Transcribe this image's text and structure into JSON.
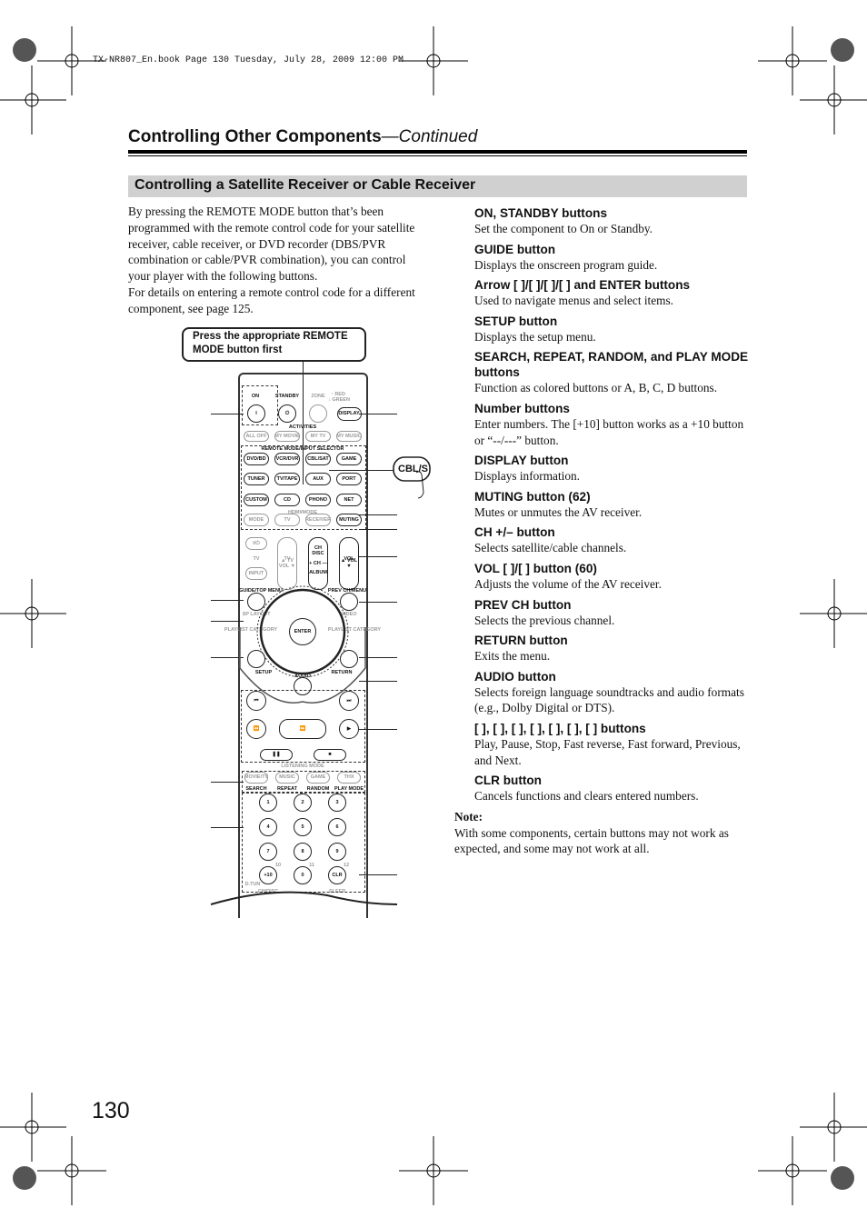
{
  "book_line": "TX-NR807_En.book  Page 130  Tuesday, July 28, 2009  12:00 PM",
  "header": {
    "title": "Controlling Other Components",
    "continued": "—Continued"
  },
  "section_title": "Controlling a Satellite Receiver or Cable Receiver",
  "intro": [
    "By pressing the REMOTE MODE button that’s been programmed with the remote control code for your satellite receiver, cable receiver, or DVD recorder (DBS/PVR combination or cable/PVR combination), you can control your player with the following buttons.",
    "For details on entering a remote control code for a different component, see page 125."
  ],
  "callout": "Press the appropriate REMOTE MODE button first",
  "cbl_callout": "CBL/S",
  "remote": {
    "labels": [
      "ON",
      "STANDBY",
      "ZONE",
      "↑ RED",
      "↓ GREEN",
      "ACTIVITIES",
      "REMOTE MODE/INPUT SELECTOR",
      "HDMI/MODE",
      "TV",
      "TV",
      "VOL",
      "CH",
      "DISC",
      "ALBUM",
      "GUIDE/TOP MENU",
      "PREV CH/MENU",
      "SP LAYOUT",
      "VIDEO",
      "PLAYLIST CATEGORY",
      "PLAYLIST CATEGORY",
      "SETUP",
      "RETURN",
      "AUDIO",
      "LISTENING MODE",
      "SEARCH",
      "REPEAT",
      "RANDOM",
      "PLAY MODE",
      "10",
      "11",
      "12",
      "D.TUN",
      "CH/DISC",
      "SLEEP"
    ],
    "buttons": [
      "I",
      "⏻",
      "",
      "DISPLAY",
      "ALL OFF",
      "MY MOVIE",
      "MY TV",
      "MY MUSIC",
      "DVD/BD",
      "VCR/DVR",
      "CBL/SAT",
      "GAME",
      "TUNER",
      "TV/TAPE",
      "AUX",
      "PORT",
      "CUSTOM",
      "CD",
      "PHONO",
      "NET",
      "MODE",
      "TV",
      "RECEIVER",
      "MUTING",
      "I/⏻",
      "INPUT",
      "▲ TV VOL ▼",
      "+ CH —",
      "▲ VOL ▼",
      "",
      "",
      "ENTER",
      "",
      "",
      "",
      "⏮",
      "⏭",
      "⏪",
      "▶",
      "⏩",
      "❚❚",
      "■",
      "MOVIE/TV",
      "MUSIC",
      "GAME",
      "THX",
      "1",
      "2",
      "3",
      "4",
      "5",
      "6",
      "7",
      "8",
      "9",
      "+10",
      "0",
      "CLR"
    ]
  },
  "items": [
    {
      "title": "ON, STANDBY buttons",
      "desc": "Set the component to On or Standby."
    },
    {
      "title": "GUIDE button",
      "desc": "Displays the onscreen program guide."
    },
    {
      "title": "Arrow [   ]/[   ]/[   ]/[   ] and ENTER buttons",
      "desc": "Used to navigate menus and select items."
    },
    {
      "title": "SETUP button",
      "desc": "Displays the setup menu."
    },
    {
      "title": "SEARCH, REPEAT, RANDOM, and PLAY MODE buttons",
      "desc": "Function as colored buttons or A, B, C, D buttons."
    },
    {
      "title": "Number buttons",
      "desc": "Enter numbers. The [+10] button works as a +10 button or “--/---” button."
    },
    {
      "title": "DISPLAY button",
      "desc": "Displays information."
    },
    {
      "title": "MUTING button (62)",
      "desc": "Mutes or unmutes the AV receiver."
    },
    {
      "title": "CH +/– button",
      "desc": "Selects satellite/cable channels."
    },
    {
      "title": "VOL [   ]/[   ] button (60)",
      "desc": "Adjusts the volume of the AV receiver."
    },
    {
      "title": "PREV CH button",
      "desc": "Selects the previous channel."
    },
    {
      "title": "RETURN button",
      "desc": "Exits the menu."
    },
    {
      "title": "AUDIO button",
      "desc": "Selects foreign language soundtracks and audio formats (e.g., Dolby Digital or DTS)."
    },
    {
      "title": "[     ], [    ], [    ], [       ], [       ], [       ], [       ] buttons",
      "desc": "Play, Pause, Stop, Fast reverse, Fast forward, Previous, and Next."
    },
    {
      "title": "CLR button",
      "desc": "Cancels functions and clears entered numbers."
    }
  ],
  "note": {
    "heading": "Note:",
    "text": "With some components, certain buttons may not work as expected, and some may not work at all."
  },
  "page_number": "130"
}
